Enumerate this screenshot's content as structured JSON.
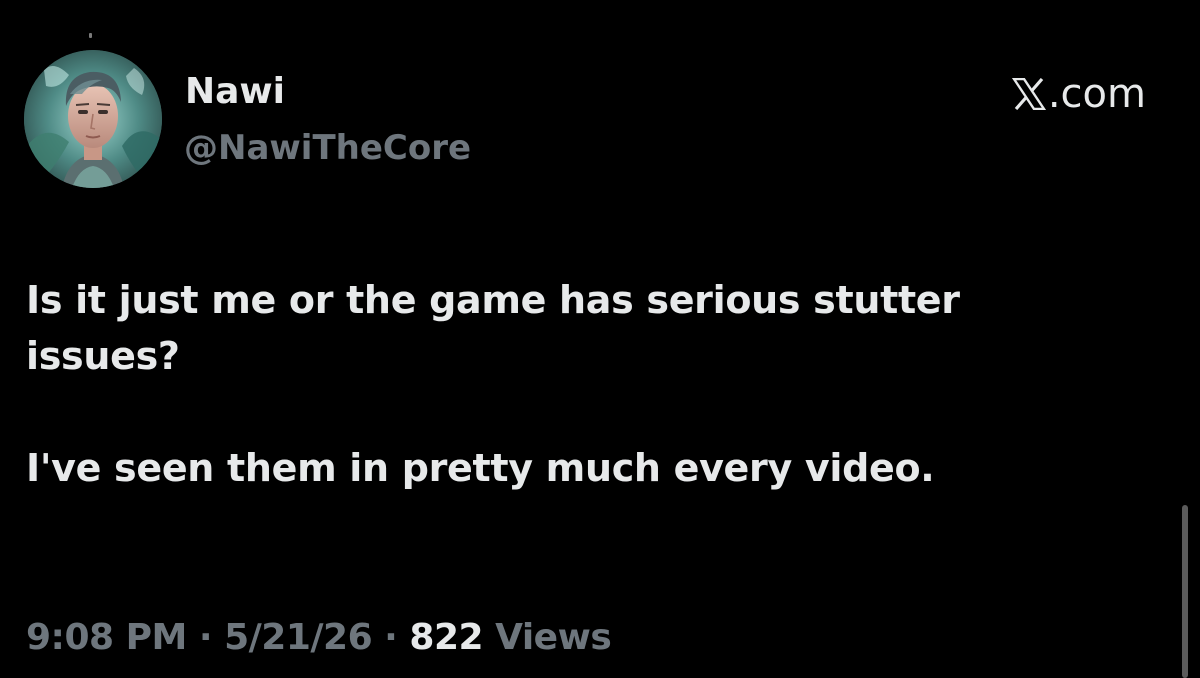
{
  "author": {
    "display_name": "Nawi",
    "handle": "@NawiTheCore"
  },
  "brand": {
    "icon": "x-logo-icon",
    "text": ".com"
  },
  "post": {
    "lines_p1": [
      "Is it just me or the game has serious stutter",
      "issues?"
    ],
    "lines_p2": [
      "I've seen them in pretty much every video."
    ]
  },
  "meta": {
    "time": "9:08 PM",
    "separator": "·",
    "date": "5/21/26",
    "views_count": "822",
    "views_label": "Views"
  },
  "colors": {
    "background": "#000000",
    "text_primary": "#e7e9ea",
    "text_secondary": "#6e767d"
  }
}
